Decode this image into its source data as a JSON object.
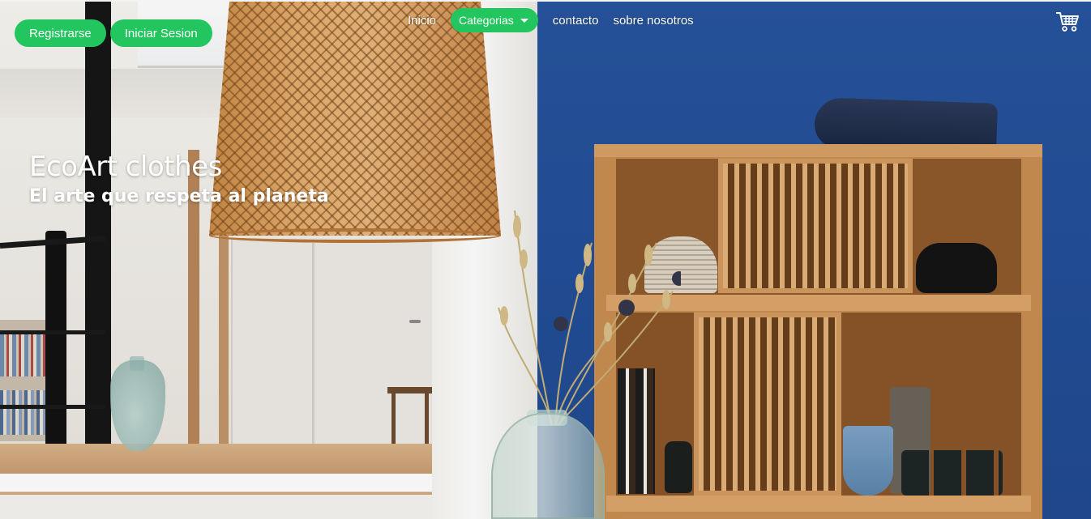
{
  "auth": {
    "register_label": "Registrarse",
    "login_label": "Iniciar Sesion"
  },
  "nav": {
    "inicio_label": "Inicio",
    "categorias_label": "Categorias",
    "contacto_label": "contacto",
    "sobre_label": "sobre nosotros"
  },
  "cart": {
    "icon": "shopping-cart-icon"
  },
  "hero": {
    "title": "EcoArt clothes",
    "subtitle": "El arte que respeta al planeta"
  },
  "colors": {
    "accent": "#22c55e",
    "blue_wall": "#234f98",
    "text_on_image": "#ffffff"
  }
}
